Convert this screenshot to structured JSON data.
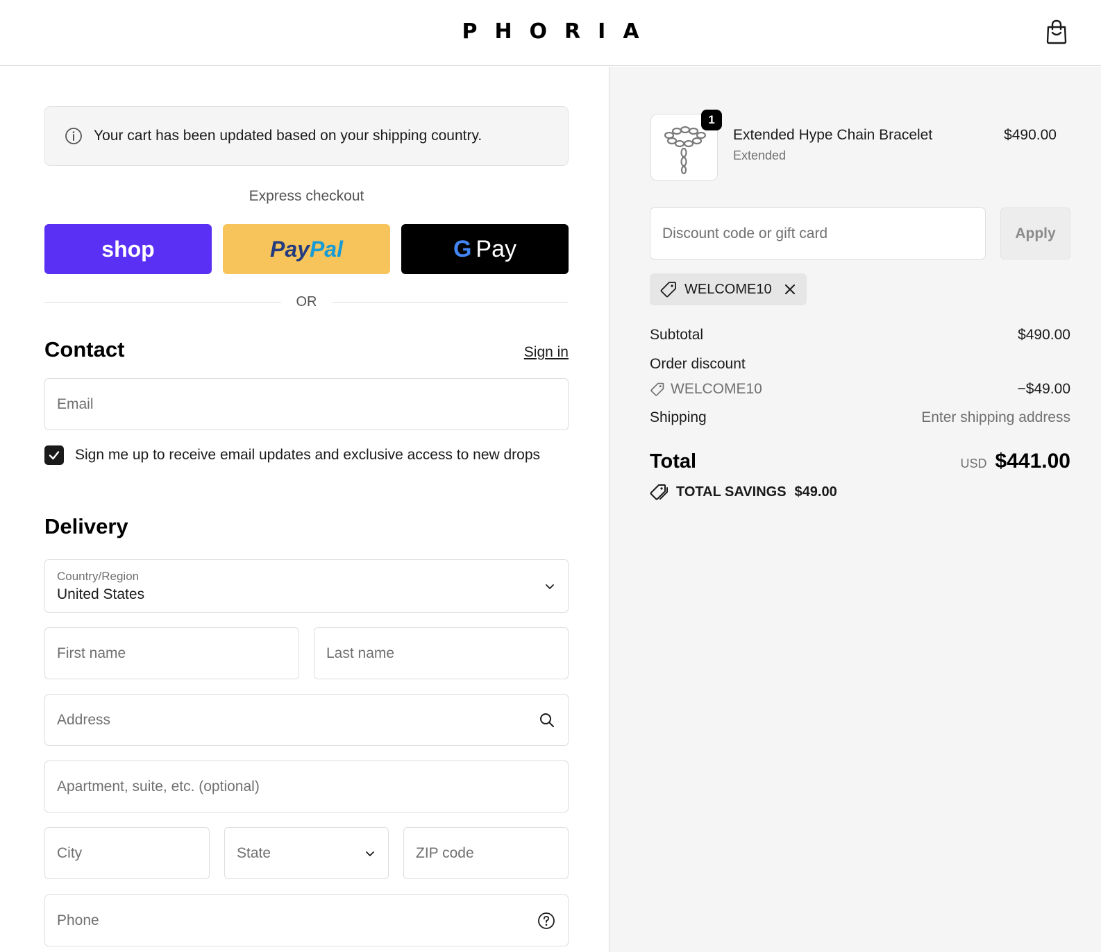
{
  "header": {
    "logo": "PHORIA",
    "cart_icon": "shopping-bag-icon"
  },
  "notice": {
    "icon": "info-icon",
    "text": "Your cart has been updated based on your shipping country."
  },
  "express": {
    "label": "Express checkout",
    "shop_label": "shop",
    "paypal_part1": "Pay",
    "paypal_part2": "Pal",
    "gpay_g": "G",
    "gpay_label": "Pay",
    "or_label": "OR"
  },
  "contact": {
    "title": "Contact",
    "signin_label": "Sign in",
    "email_placeholder": "Email",
    "newsletter_label": "Sign me up to receive email updates and exclusive access to new drops",
    "newsletter_checked": true
  },
  "delivery": {
    "title": "Delivery",
    "country_label": "Country/Region",
    "country_value": "United States",
    "first_name_placeholder": "First name",
    "last_name_placeholder": "Last name",
    "address_placeholder": "Address",
    "apartment_placeholder": "Apartment, suite, etc. (optional)",
    "city_placeholder": "City",
    "state_placeholder": "State",
    "zip_placeholder": "ZIP code",
    "phone_placeholder": "Phone"
  },
  "order": {
    "item": {
      "quantity": "1",
      "name": "Extended Hype Chain Bracelet",
      "variant": "Extended",
      "price": "$490.00"
    },
    "discount_placeholder": "Discount code or gift card",
    "apply_label": "Apply",
    "applied_code": "WELCOME10",
    "subtotal_label": "Subtotal",
    "subtotal_value": "$490.00",
    "order_discount_label": "Order discount",
    "discount_code": "WELCOME10",
    "discount_value": "−$49.00",
    "shipping_label": "Shipping",
    "shipping_value": "Enter shipping address",
    "total_label": "Total",
    "currency": "USD",
    "total_value": "$441.00",
    "savings_label": "TOTAL SAVINGS",
    "savings_value": "$49.00"
  },
  "colors": {
    "shop_pay": "#5a31f4",
    "paypal": "#f6c45a",
    "gpay": "#000000",
    "summary_bg": "#f5f5f5"
  }
}
